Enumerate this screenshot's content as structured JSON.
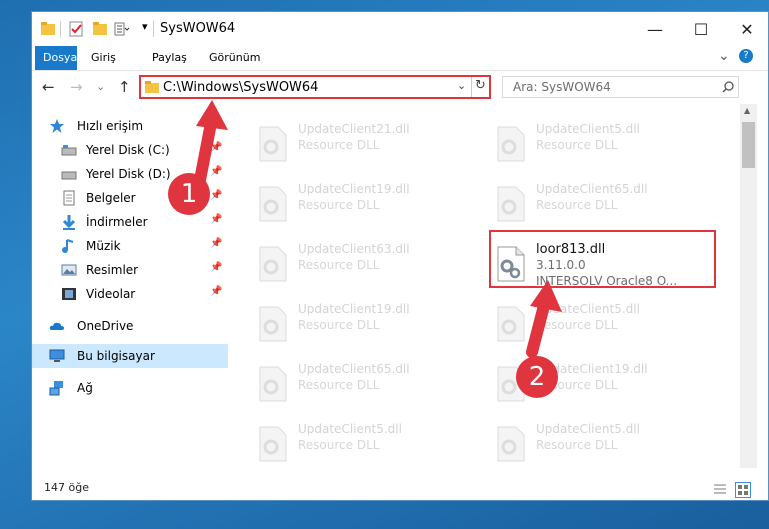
{
  "window": {
    "title": "SysWOW64",
    "controls": {
      "minimize": "—",
      "maximize": "☐",
      "close": "✕"
    }
  },
  "ribbon": {
    "tabs": [
      {
        "label": "Dosya"
      },
      {
        "label": "Giriş"
      },
      {
        "label": "Paylaş"
      },
      {
        "label": "Görünüm"
      }
    ],
    "expand_glyph": "⌄",
    "help_glyph": "?"
  },
  "nav": {
    "back": "←",
    "forward": "→",
    "recent": "⌄",
    "up": "↑",
    "address": "C:\\Windows\\SysWOW64",
    "search_placeholder": "Ara: SysWOW64"
  },
  "sidebar": {
    "items": [
      {
        "label": "Hızlı erişim",
        "icon": "star-icon",
        "pinned": false
      },
      {
        "label": "Yerel Disk (C:)",
        "icon": "drive-c-icon",
        "pinned": true
      },
      {
        "label": "Yerel Disk (D:)",
        "icon": "drive-d-icon",
        "pinned": true
      },
      {
        "label": "Belgeler",
        "icon": "documents-icon",
        "pinned": true
      },
      {
        "label": "İndirmeler",
        "icon": "downloads-icon",
        "pinned": true
      },
      {
        "label": "Müzik",
        "icon": "music-icon",
        "pinned": true
      },
      {
        "label": "Resimler",
        "icon": "pictures-icon",
        "pinned": true
      },
      {
        "label": "Videolar",
        "icon": "videos-icon",
        "pinned": true
      },
      {
        "label": "OneDrive",
        "icon": "onedrive-icon",
        "pinned": false
      },
      {
        "label": "Bu bilgisayar",
        "icon": "computer-icon",
        "pinned": false,
        "selected": true
      },
      {
        "label": "Ağ",
        "icon": "network-icon",
        "pinned": false
      }
    ],
    "pin_glyph": "📌"
  },
  "files": [
    {
      "name": "UpdateClient21.dll",
      "desc": "Resource DLL"
    },
    {
      "name": "UpdateClient5.dll",
      "desc": "Resource DLL"
    },
    {
      "name": "UpdateClient19.dll",
      "desc": "Resource DLL"
    },
    {
      "name": "UpdateClient65.dll",
      "desc": "Resource DLL"
    },
    {
      "name": "UpdateClient63.dll",
      "desc": "Resource DLL"
    },
    {
      "name": "loor813.dll",
      "version": "3.11.0.0",
      "desc": "INTERSOLV Oracle8 O...",
      "focused": true
    },
    {
      "name": "UpdateClient19.dll",
      "desc": "Resource DLL"
    },
    {
      "name": "UpdateClient5.dll",
      "desc": "Resource DLL"
    },
    {
      "name": "UpdateClient65.dll",
      "desc": "Resource DLL"
    },
    {
      "name": "UpdateClient19.dll",
      "desc": "Resource DLL"
    },
    {
      "name": "UpdateClient5.dll",
      "desc": "Resource DLL"
    },
    {
      "name": "UpdateClient5.dll",
      "desc": "Resource DLL"
    }
  ],
  "status": {
    "count": "147 öğe"
  },
  "annotations": {
    "step1": "1",
    "step2": "2"
  },
  "colors": {
    "accent": "#1979ca",
    "highlight": "#e0343f",
    "selection": "#cce8ff"
  }
}
